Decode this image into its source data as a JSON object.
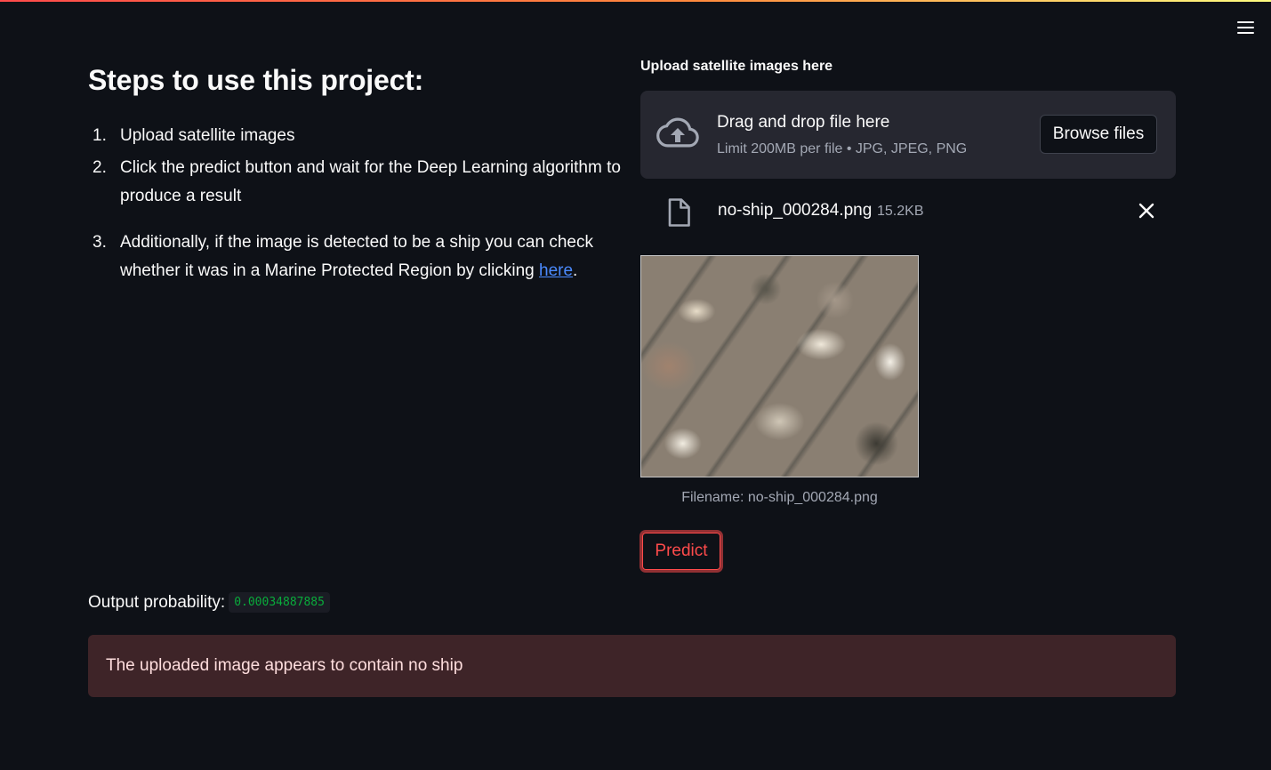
{
  "header": {
    "menu_icon": "hamburger-menu-icon"
  },
  "instructions": {
    "title": "Steps to use this project:",
    "steps": [
      {
        "number": "1.",
        "text": "Upload satellite images"
      },
      {
        "number": "2.",
        "text": "Click the predict button and wait for the Deep Learning algorithm to produce a result"
      },
      {
        "number": "3.",
        "text_before": "Additionally, if the image is detected to be a ship you can check whether it was in a Marine Protected Region by clicking ",
        "link_text": "here",
        "text_after": "."
      }
    ]
  },
  "uploader": {
    "label": "Upload satellite images here",
    "drop_title": "Drag and drop file here",
    "drop_limit": "Limit 200MB per file • JPG, JPEG, PNG",
    "browse_label": "Browse files",
    "upload_icon": "cloud-upload-icon",
    "file": {
      "name": "no-ship_000284.png",
      "size": "15.2KB",
      "file_icon": "file-icon",
      "close_icon": "close-icon"
    }
  },
  "preview": {
    "caption": "Filename: no-ship_000284.png"
  },
  "actions": {
    "predict_label": "Predict"
  },
  "result": {
    "output_label": "Output probability:",
    "output_value": "0.00034887885",
    "message": "The uploaded image appears to contain no ship"
  },
  "colors": {
    "background": "#0e1117",
    "accent": "#ff4b4b",
    "link": "#4b8bff",
    "code_text": "#09ab3b",
    "error_bg": "#3e2428"
  }
}
